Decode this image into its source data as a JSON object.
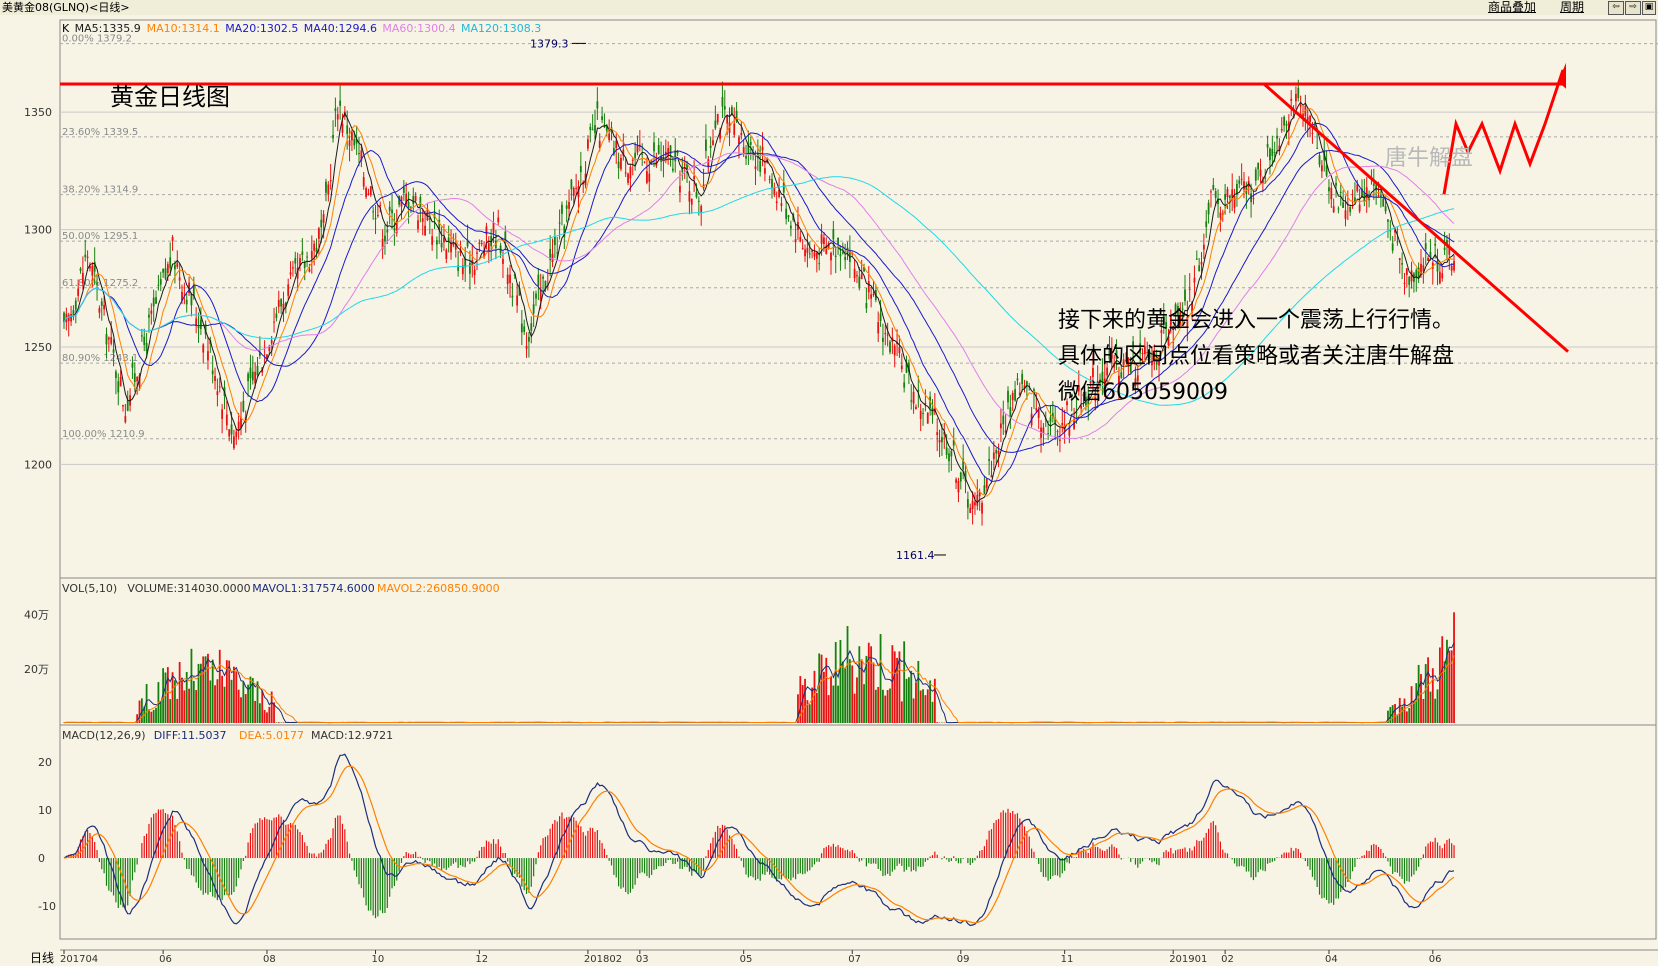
{
  "window": {
    "title": "美黄金08(GLNQ)<日线>",
    "menu": [
      {
        "id": "overlay",
        "label": "商品叠加"
      },
      {
        "id": "period",
        "label": "周期"
      }
    ],
    "nav_icons": [
      "arrow-left-icon",
      "arrow-right-icon",
      "window-restore-icon"
    ]
  },
  "colors": {
    "background": "#f7f4e6",
    "grid": "#c8c8c8",
    "up": "#e81010",
    "down": "#15800f",
    "ma5": "#1a1a1a",
    "ma10": "#ff8000",
    "ma20": "#1a1ac8",
    "ma60": "#e080e8",
    "ma120": "#20d8e8",
    "trendline": "#ff0000",
    "dif": "#1c2e7a",
    "dea": "#ff8000"
  },
  "price_panel": {
    "legend": [
      {
        "key": "K",
        "text": "K",
        "color": "#000000"
      },
      {
        "key": "ma5",
        "text": "MA5:1335.9",
        "color": "#1a1a1a"
      },
      {
        "key": "ma10",
        "text": "MA10:1314.1",
        "color": "#ff8000"
      },
      {
        "key": "ma20",
        "text": "MA20:1302.5",
        "color": "#1a1ac8"
      },
      {
        "key": "ma40",
        "text": "MA40:1294.6",
        "color": "#1a1ac8"
      },
      {
        "key": "ma60",
        "text": "MA60:1300.4",
        "color": "#e080e8"
      },
      {
        "key": "ma120",
        "text": "MA120:1308.3",
        "color": "#20b8d8"
      }
    ],
    "fib_labels": [
      "0.00% 1379.2",
      "23.60% 1339.5",
      "38.20% 1314.9",
      "50.00% 1295.1",
      "61.80% 1275.2",
      "80.90% 1243.1",
      "100.00% 1210.9"
    ],
    "fib_values": [
      1379.2,
      1339.5,
      1314.9,
      1295.1,
      1275.2,
      1243.1,
      1210.9
    ],
    "y_ticks": [
      "1350",
      "1300",
      "1250",
      "1200"
    ],
    "y_tick_values": [
      1350,
      1300,
      1250,
      1200
    ],
    "high_marker": "1379.3",
    "low_marker": "1161.4",
    "annotation_title": "黄金日线图",
    "annotation_lines": [
      "接下来的黄金会进入一个震荡上行行情。",
      "具体的区间点位看策略或者关注唐牛解盘",
      "微信605059009"
    ],
    "watermark": "唐牛解盘",
    "resistance_level": 1362,
    "ylim": [
      1155,
      1385
    ]
  },
  "volume_panel": {
    "legend": [
      {
        "key": "vol",
        "text": "VOL(5,10)",
        "color": "#333333"
      },
      {
        "key": "volume",
        "text": "VOLUME:314030.0000",
        "color": "#333333"
      },
      {
        "key": "mavol1",
        "text": "MAVOL1:317574.6000",
        "color": "#1a2a80"
      },
      {
        "key": "mavol2",
        "text": "MAVOL2:260850.9000",
        "color": "#ff8000"
      }
    ],
    "y_ticks": [
      "40万",
      "20万"
    ],
    "y_tick_values": [
      400000,
      200000
    ],
    "ylim": [
      0,
      520000
    ]
  },
  "macd_panel": {
    "legend": [
      {
        "key": "macd",
        "text": "MACD(12,26,9)",
        "color": "#333333"
      },
      {
        "key": "diff",
        "text": "DIFF:11.5037",
        "color": "#1a2a80"
      },
      {
        "key": "dea",
        "text": "DEA:5.0177",
        "color": "#ff8000"
      },
      {
        "key": "macdv",
        "text": "MACD:12.9721",
        "color": "#333333"
      }
    ],
    "y_ticks": [
      "20",
      "10",
      "0",
      "-10"
    ],
    "y_tick_values": [
      20,
      10,
      0,
      -10
    ],
    "ylim": [
      -16,
      26
    ]
  },
  "x_axis": {
    "period_label": "日线",
    "ticks": [
      "201704",
      "06",
      "08",
      "10",
      "12",
      "201802",
      "03",
      "05",
      "07",
      "09",
      "11",
      "201901",
      "02",
      "04",
      "06"
    ],
    "tick_index": [
      0,
      42,
      86,
      132,
      176,
      222,
      244,
      288,
      334,
      380,
      424,
      470,
      492,
      536,
      580
    ]
  },
  "chart_data": {
    "type": "candlestick",
    "x_start": "2017-04",
    "x_end": "2019-06",
    "bars": 590,
    "close_keypoints": [
      {
        "i": 0,
        "v": 1255
      },
      {
        "i": 10,
        "v": 1290
      },
      {
        "i": 26,
        "v": 1225
      },
      {
        "i": 46,
        "v": 1290
      },
      {
        "i": 60,
        "v": 1255
      },
      {
        "i": 72,
        "v": 1212
      },
      {
        "i": 90,
        "v": 1265
      },
      {
        "i": 110,
        "v": 1300
      },
      {
        "i": 116,
        "v": 1355
      },
      {
        "i": 136,
        "v": 1300
      },
      {
        "i": 146,
        "v": 1315
      },
      {
        "i": 170,
        "v": 1285
      },
      {
        "i": 184,
        "v": 1300
      },
      {
        "i": 196,
        "v": 1255
      },
      {
        "i": 226,
        "v": 1345
      },
      {
        "i": 236,
        "v": 1330
      },
      {
        "i": 256,
        "v": 1330
      },
      {
        "i": 270,
        "v": 1315
      },
      {
        "i": 276,
        "v": 1350
      },
      {
        "i": 296,
        "v": 1330
      },
      {
        "i": 316,
        "v": 1290
      },
      {
        "i": 330,
        "v": 1295
      },
      {
        "i": 360,
        "v": 1230
      },
      {
        "i": 374,
        "v": 1210
      },
      {
        "i": 386,
        "v": 1180
      },
      {
        "i": 396,
        "v": 1210
      },
      {
        "i": 404,
        "v": 1235
      },
      {
        "i": 420,
        "v": 1215
      },
      {
        "i": 440,
        "v": 1240
      },
      {
        "i": 460,
        "v": 1245
      },
      {
        "i": 476,
        "v": 1265
      },
      {
        "i": 486,
        "v": 1310
      },
      {
        "i": 506,
        "v": 1320
      },
      {
        "i": 520,
        "v": 1355
      },
      {
        "i": 530,
        "v": 1340
      },
      {
        "i": 540,
        "v": 1310
      },
      {
        "i": 556,
        "v": 1320
      },
      {
        "i": 568,
        "v": 1280
      },
      {
        "i": 580,
        "v": 1290
      },
      {
        "i": 590,
        "v": 1285
      },
      {
        "i": 596,
        "v": 1300
      },
      {
        "i": 604,
        "v": 1340
      }
    ],
    "extremes": {
      "high": 1379.3,
      "low": 1161.4
    }
  }
}
